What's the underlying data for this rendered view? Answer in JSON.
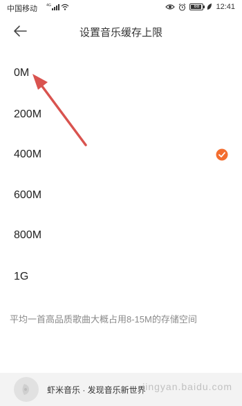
{
  "status_bar": {
    "carrier": "中国移动",
    "time": "12:41",
    "battery": "88"
  },
  "header": {
    "title": "设置音乐缓存上限",
    "back_icon": "arrow-left-icon"
  },
  "options": [
    {
      "label": "0M",
      "selected": false
    },
    {
      "label": "200M",
      "selected": false
    },
    {
      "label": "400M",
      "selected": true
    },
    {
      "label": "600M",
      "selected": false
    },
    {
      "label": "800M",
      "selected": false
    },
    {
      "label": "1G",
      "selected": false
    }
  ],
  "note": "平均一首高品质歌曲大概占用8-15M的存储空间",
  "banner": {
    "text": "虾米音乐 · 发现音乐新世界",
    "watermark": "jingyan.baidu.com"
  },
  "colors": {
    "accent": "#f36d2f",
    "annotation_arrow": "#d9534f",
    "note_text": "#8a8a8a",
    "banner_bg": "#f3f3f3"
  }
}
